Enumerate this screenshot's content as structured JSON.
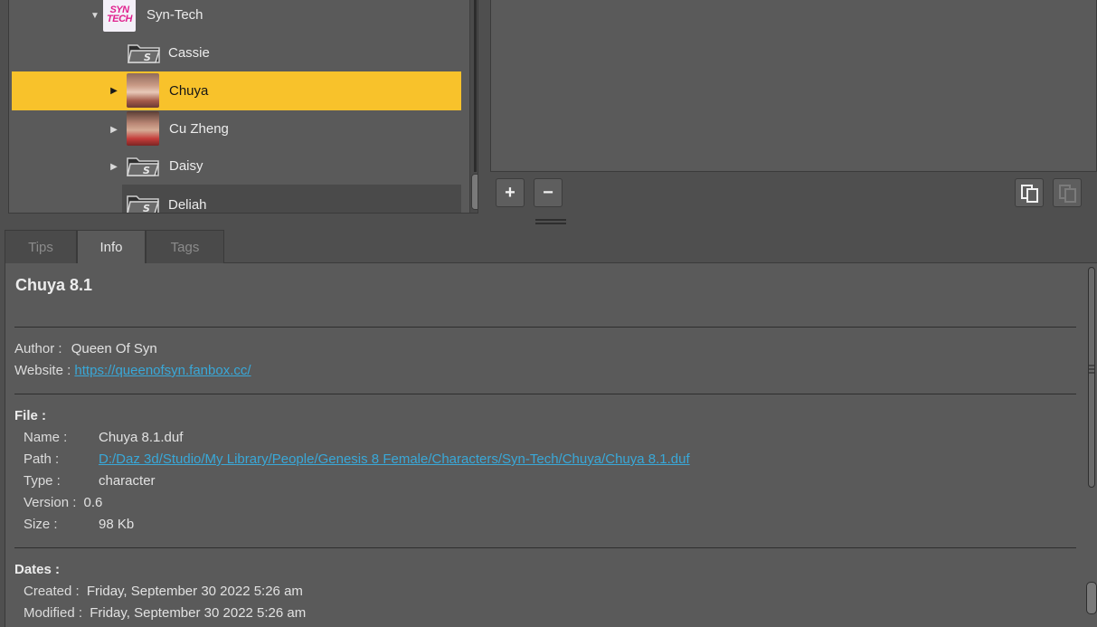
{
  "tree": {
    "items": [
      {
        "label": "Syn-Tech",
        "expanded": true,
        "logo": [
          "SYN",
          "TECH"
        ]
      },
      {
        "label": "Cassie"
      },
      {
        "label": "Chuya",
        "selected": true
      },
      {
        "label": "Cu Zheng"
      },
      {
        "label": "Daisy"
      },
      {
        "label": "Deliah"
      }
    ]
  },
  "buttons": {
    "add": "+",
    "remove": "−"
  },
  "tabs": [
    {
      "label": "Tips"
    },
    {
      "label": "Info",
      "active": true
    },
    {
      "label": "Tags"
    }
  ],
  "info": {
    "title": "Chuya 8.1",
    "author_label": "Author :",
    "author": "Queen Of Syn",
    "website_label": "Website :",
    "website": "https://queenofsyn.fanbox.cc/",
    "file_head": "File :",
    "file": {
      "name_label": "Name :",
      "name": "Chuya 8.1.duf",
      "path_label": "Path :",
      "path": "D:/Daz 3d/Studio/My Library/People/Genesis 8 Female/Characters/Syn-Tech/Chuya/Chuya 8.1.duf",
      "type_label": "Type :",
      "type": "character",
      "version_label": "Version :",
      "version": "0.6",
      "size_label": "Size :",
      "size": "98 Kb"
    },
    "dates_head": "Dates :",
    "dates": {
      "created_label": "Created :",
      "created": "Friday, September 30 2022 5:26 am",
      "modified_label": "Modified :",
      "modified": "Friday, September 30 2022 5:26 am"
    }
  },
  "colors": {
    "selection": "#f8c22b",
    "link": "#39a8d8",
    "panel": "#5a5a5a"
  }
}
